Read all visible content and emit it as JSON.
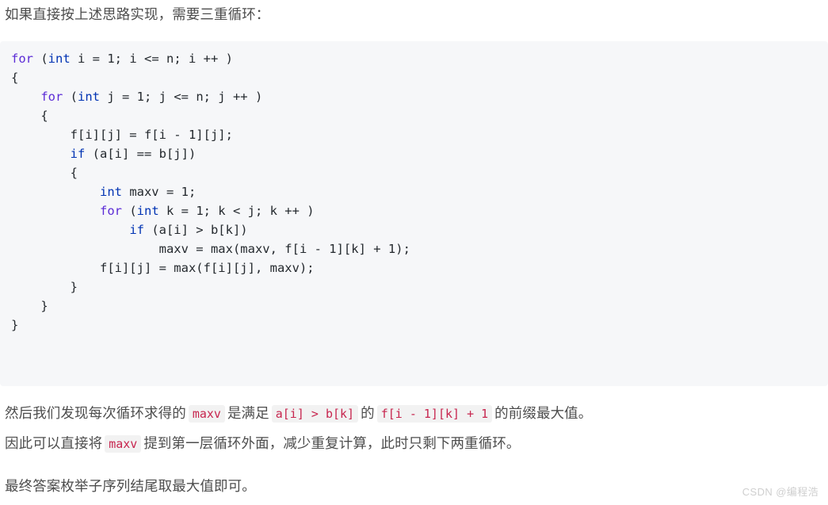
{
  "document": {
    "intro_text": "如果直接按上述思路实现，需要三重循环：",
    "code_block": {
      "language": "cpp",
      "lines": [
        [
          {
            "t": "for",
            "c": "kw-for"
          },
          {
            "t": " (",
            "c": "plain"
          },
          {
            "t": "int",
            "c": "kw"
          },
          {
            "t": " i = 1; i <= n; i ++ )",
            "c": "plain"
          }
        ],
        [
          {
            "t": "{",
            "c": "plain"
          }
        ],
        [
          {
            "t": "    ",
            "c": "plain"
          },
          {
            "t": "for",
            "c": "kw-for"
          },
          {
            "t": " (",
            "c": "plain"
          },
          {
            "t": "int",
            "c": "kw"
          },
          {
            "t": " j = 1; j <= n; j ++ )",
            "c": "plain"
          }
        ],
        [
          {
            "t": "    {",
            "c": "plain"
          }
        ],
        [
          {
            "t": "        f[i][j] = f[i - 1][j];",
            "c": "plain"
          }
        ],
        [
          {
            "t": "        ",
            "c": "plain"
          },
          {
            "t": "if",
            "c": "kw"
          },
          {
            "t": " (a[i] == b[j])",
            "c": "plain"
          }
        ],
        [
          {
            "t": "        {",
            "c": "plain"
          }
        ],
        [
          {
            "t": "            ",
            "c": "plain"
          },
          {
            "t": "int",
            "c": "kw"
          },
          {
            "t": " maxv = 1;",
            "c": "plain"
          }
        ],
        [
          {
            "t": "            ",
            "c": "plain"
          },
          {
            "t": "for",
            "c": "kw-for"
          },
          {
            "t": " (",
            "c": "plain"
          },
          {
            "t": "int",
            "c": "kw"
          },
          {
            "t": " k = 1; k < j; k ++ )",
            "c": "plain"
          }
        ],
        [
          {
            "t": "                ",
            "c": "plain"
          },
          {
            "t": "if",
            "c": "kw"
          },
          {
            "t": " (a[i] > b[k])",
            "c": "plain"
          }
        ],
        [
          {
            "t": "                    maxv = max(maxv, f[i - 1][k] + 1);",
            "c": "plain"
          }
        ],
        [
          {
            "t": "            f[i][j] = max(f[i][j], maxv);",
            "c": "plain"
          }
        ],
        [
          {
            "t": "        }",
            "c": "plain"
          }
        ],
        [
          {
            "t": "    }",
            "c": "plain"
          }
        ],
        [
          {
            "t": "}",
            "c": "plain"
          }
        ]
      ]
    },
    "paragraph_1": {
      "seg_1": "然后我们发现每次循环求得的",
      "code_1": "maxv",
      "seg_2": "是满足",
      "code_2": "a[i] > b[k]",
      "seg_3": "的",
      "code_3": "f[i - 1][k] + 1",
      "seg_4": "的前缀最大值。"
    },
    "paragraph_2": {
      "seg_1": "因此可以直接将",
      "code_1": "maxv",
      "seg_2": "提到第一层循环外面，减少重复计算，此时只剩下两重循环。"
    },
    "paragraph_3": {
      "text": "最终答案枚举子序列结尾取最大值即可。"
    },
    "watermark": {
      "text": "CSDN @编程浩"
    },
    "colors": {
      "code_block_bg": "#f6f7f9",
      "inline_code_bg": "#f2f2f2",
      "inline_code_fg": "#c7254e",
      "keyword_blue": "#0033b3",
      "keyword_violet": "#5b2bd6",
      "body_text": "#4d4d4d",
      "watermark": "#cfcfcf"
    }
  }
}
